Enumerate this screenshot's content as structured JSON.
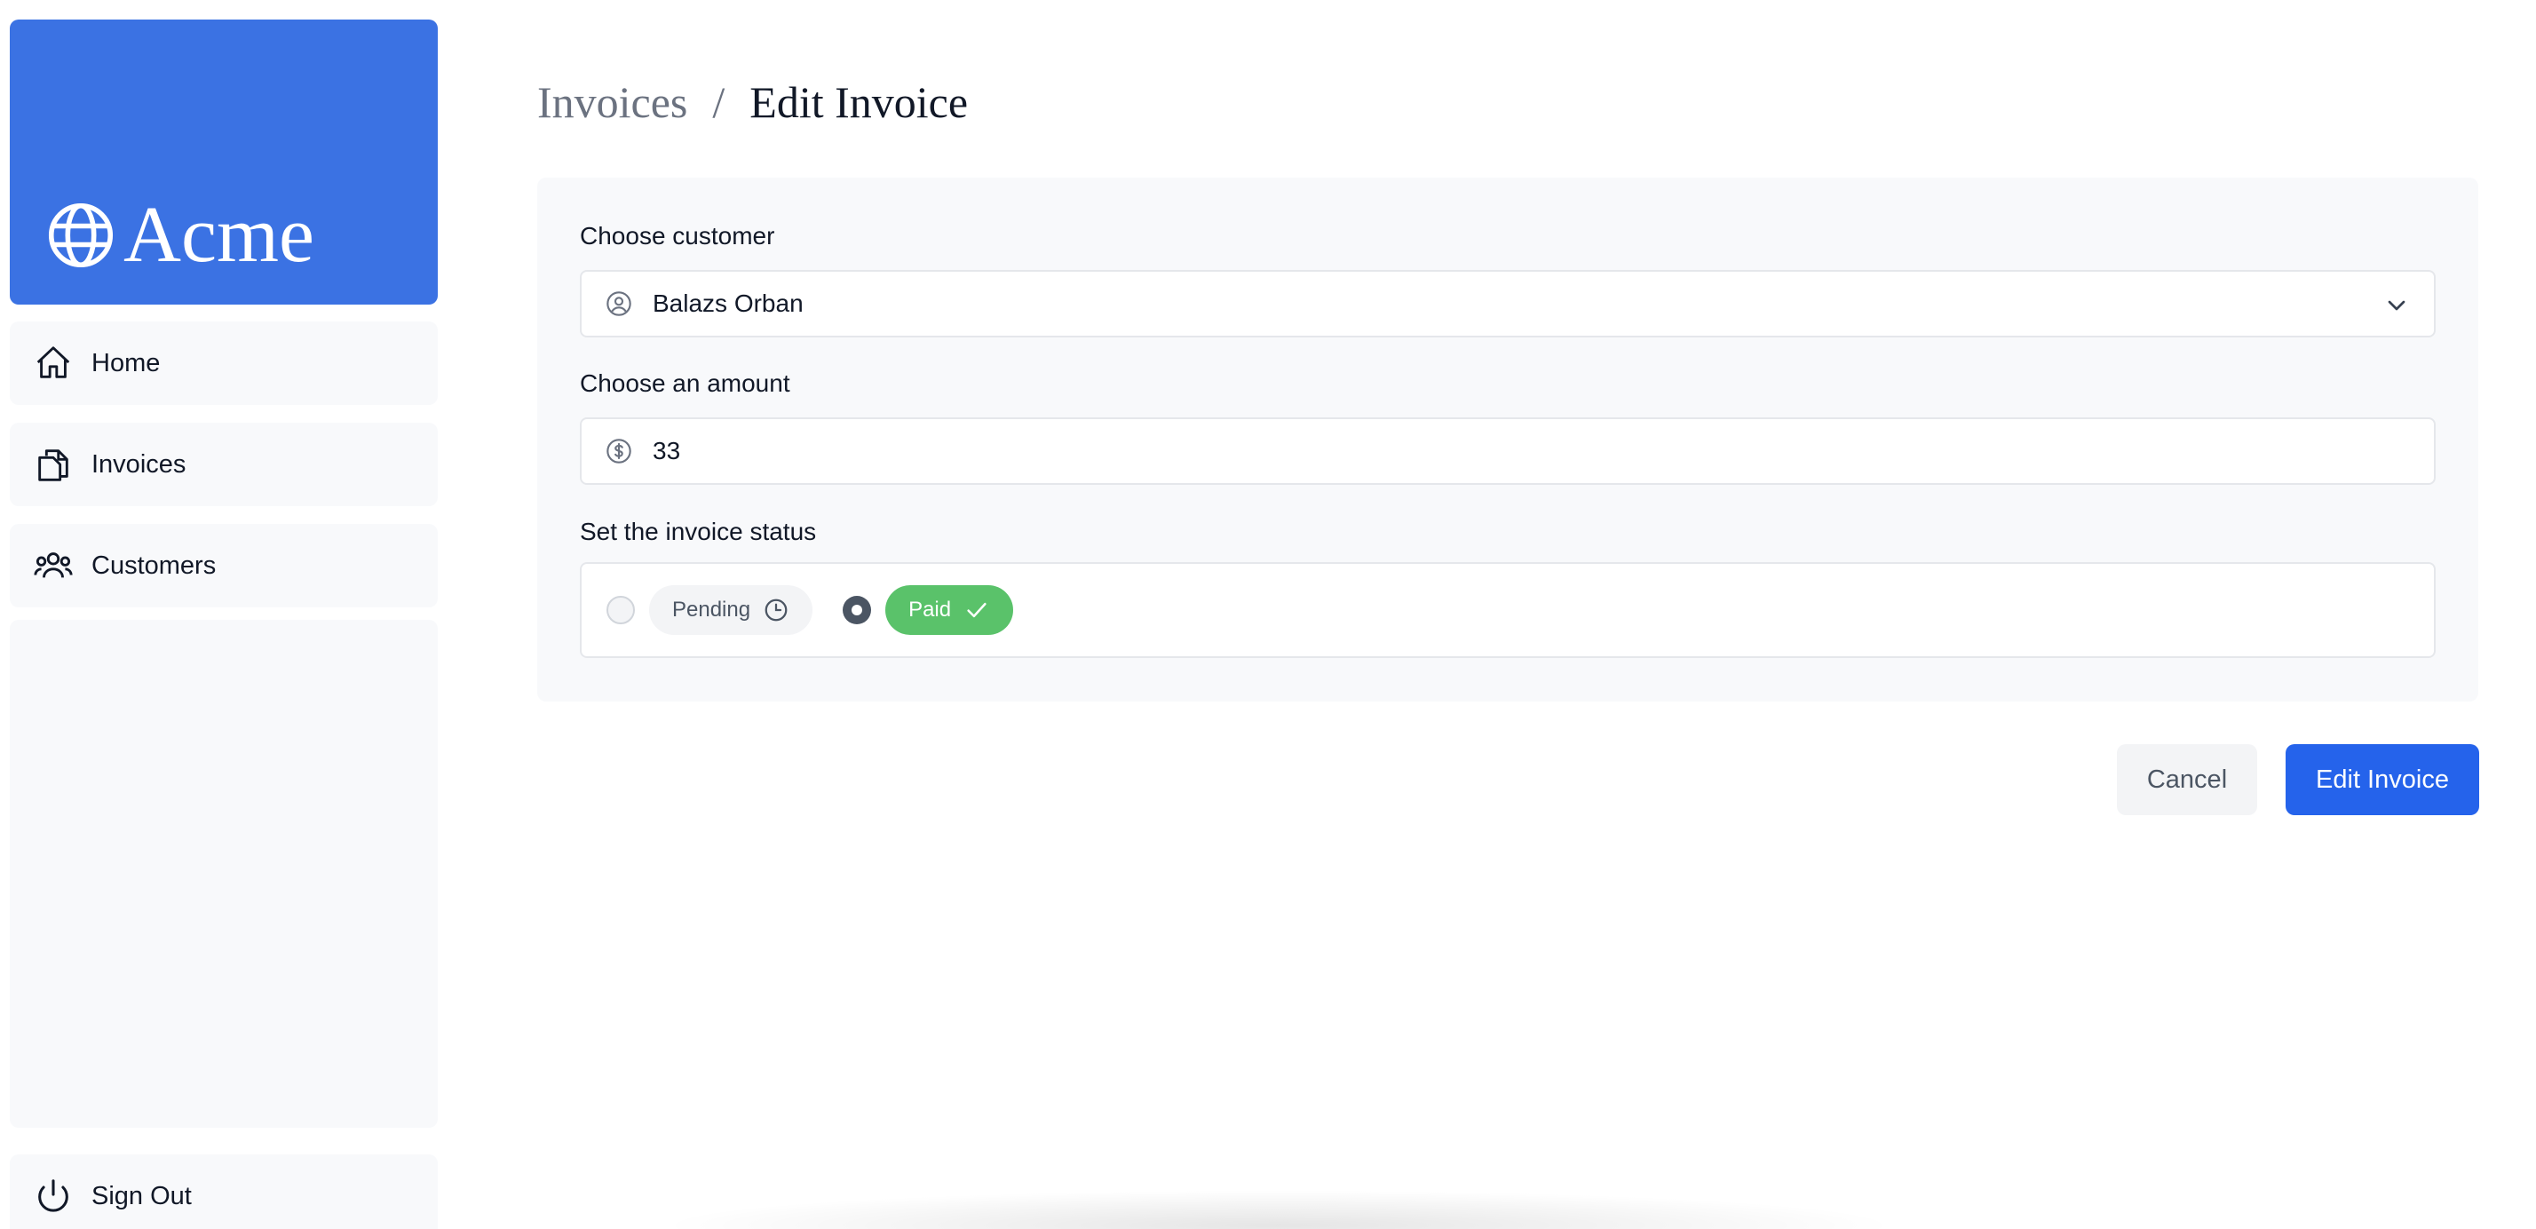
{
  "app": {
    "name": "Acme"
  },
  "sidebar": {
    "items": [
      {
        "label": "Home",
        "icon": "home-icon"
      },
      {
        "label": "Invoices",
        "icon": "document-duplicate-icon"
      },
      {
        "label": "Customers",
        "icon": "user-group-icon"
      }
    ],
    "sign_out": {
      "label": "Sign Out",
      "icon": "power-icon"
    }
  },
  "breadcrumb": {
    "parent": "Invoices",
    "separator": "/",
    "current": "Edit Invoice"
  },
  "form": {
    "customer": {
      "label": "Choose customer",
      "value": "Balazs Orban",
      "icon": "user-circle-icon"
    },
    "amount": {
      "label": "Choose an amount",
      "value": "33",
      "icon": "currency-dollar-icon"
    },
    "status": {
      "label": "Set the invoice status",
      "options": [
        {
          "label": "Pending",
          "checked": false,
          "icon": "clock-icon"
        },
        {
          "label": "Paid",
          "checked": true,
          "icon": "check-icon"
        }
      ]
    }
  },
  "actions": {
    "cancel": "Cancel",
    "submit": "Edit Invoice"
  },
  "colors": {
    "brand": "#3b72e3",
    "primary_button": "#2563eb",
    "paid_green": "#5ac26a",
    "panel_bg": "#f8f9fb"
  }
}
